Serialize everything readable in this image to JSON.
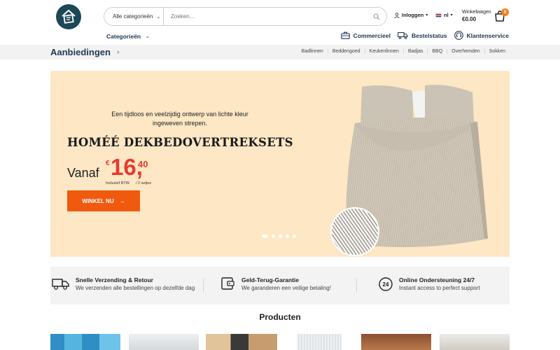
{
  "header": {
    "logo_icon": "home-logo-icon",
    "search": {
      "category_label": "Alle categorieën",
      "placeholder": "Zoeken..."
    },
    "login_label": "Inloggen",
    "language_label": "nl",
    "cart": {
      "label": "Winkelwagen",
      "amount": "€0.00",
      "count": "0"
    },
    "categories_label": "Categorieën",
    "links": [
      {
        "label": "Commercieel",
        "icon": "briefcase-icon"
      },
      {
        "label": "Bestelstatus",
        "icon": "truck-icon"
      },
      {
        "label": "Klantenservice",
        "icon": "headset-icon"
      }
    ]
  },
  "subbar": {
    "title": "Aanbiedingen",
    "nav": [
      "Badlinnen",
      "Beddengoed",
      "Keukenlinnen",
      "Badjas",
      "BBQ",
      "Overhemden",
      "Sokken"
    ]
  },
  "hero": {
    "tagline": "Een tijdloos en veelzijdig ontwerp van lichte kleur ingeweven strepen.",
    "headline": "HOMÉÉ DEKBEDOVERTREKSETS",
    "from_label": "Vanaf",
    "currency": "€",
    "price_main": "16,",
    "price_cents": "40",
    "vat_note": "Inclusief BTW",
    "sets_note": "/ 2 setjes",
    "button_label": "WINKEL NU",
    "slide_count": 5,
    "active_slide": 1
  },
  "features": [
    {
      "title": "Snelle Verzending & Retour",
      "subtitle": "We verzenden alle bestellingen op dezelfde dag",
      "icon": "delivery-truck-icon"
    },
    {
      "title": "Geld-Terug-Garantie",
      "subtitle": "We garanderen een veilige betaling!",
      "icon": "wallet-icon"
    },
    {
      "title": "Online Ondersteuning 24/7",
      "subtitle": "Instant access to perfect support",
      "icon": "support-24-icon"
    }
  ],
  "products": {
    "title": "Producten",
    "thumbnails": [
      {
        "name": "product-blue-towels",
        "color": "#3aa6d8"
      },
      {
        "name": "product-bathroom",
        "color": "#d9dde0"
      },
      {
        "name": "product-bedroom-dark",
        "color": "#c9a27a"
      },
      {
        "name": "product-white-towel",
        "color": "#e9ecef"
      },
      {
        "name": "product-bed-red",
        "color": "#a0653a"
      },
      {
        "name": "product-bed-light",
        "color": "#d8d5cf"
      }
    ]
  },
  "colors": {
    "brand": "#223a54",
    "accent": "#f05a0f",
    "price": "#e73a2f",
    "badge": "#f07f1e"
  }
}
